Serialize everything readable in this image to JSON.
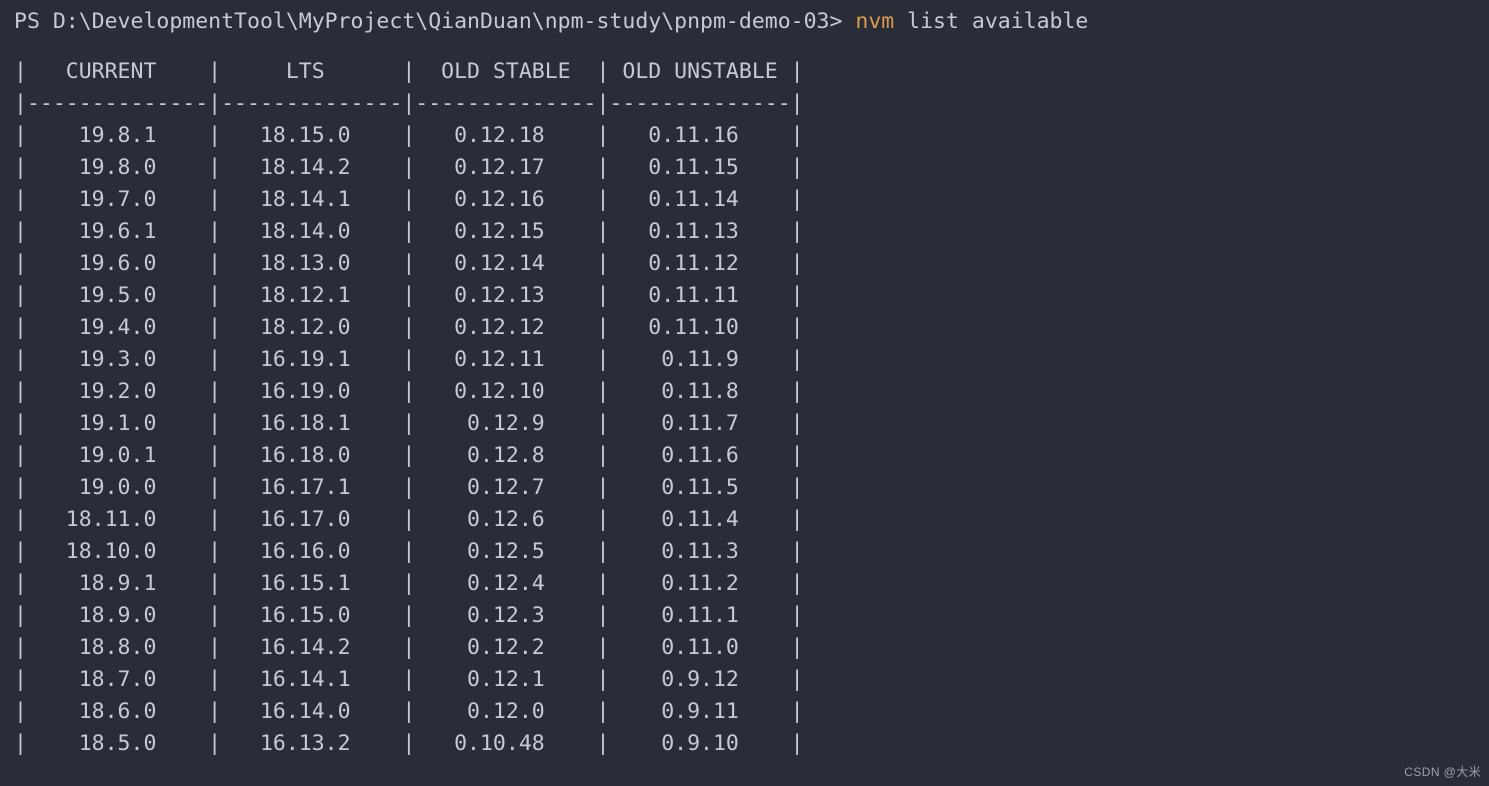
{
  "terminal": {
    "background_color": "#292d38",
    "foreground_color": "#c6cad3",
    "command_color": "#d99a4e",
    "prompt": {
      "shell": "PS",
      "path": "D:\\DevelopmentTool\\MyProject\\QianDuan\\npm-study\\pnpm-demo-03>",
      "prefix_text": "PS D:\\DevelopmentTool\\MyProject\\QianDuan\\npm-study\\pnpm-demo-03> ",
      "command": "nvm",
      "arguments": " list available"
    },
    "watermark": "CSDN @大米"
  },
  "table": {
    "blank_line": "",
    "header_row": "|   CURRENT    |     LTS      |  OLD STABLE  | OLD UNSTABLE |",
    "separator_row": "|--------------|--------------|--------------|--------------|",
    "columns": [
      "CURRENT",
      "LTS",
      "OLD STABLE",
      "OLD UNSTABLE"
    ],
    "rows": [
      "|    19.8.1    |   18.15.0    |   0.12.18    |   0.11.16    |",
      "|    19.8.0    |   18.14.2    |   0.12.17    |   0.11.15    |",
      "|    19.7.0    |   18.14.1    |   0.12.16    |   0.11.14    |",
      "|    19.6.1    |   18.14.0    |   0.12.15    |   0.11.13    |",
      "|    19.6.0    |   18.13.0    |   0.12.14    |   0.11.12    |",
      "|    19.5.0    |   18.12.1    |   0.12.13    |   0.11.11    |",
      "|    19.4.0    |   18.12.0    |   0.12.12    |   0.11.10    |",
      "|    19.3.0    |   16.19.1    |   0.12.11    |    0.11.9    |",
      "|    19.2.0    |   16.19.0    |   0.12.10    |    0.11.8    |",
      "|    19.1.0    |   16.18.1    |    0.12.9    |    0.11.7    |",
      "|    19.0.1    |   16.18.0    |    0.12.8    |    0.11.6    |",
      "|    19.0.0    |   16.17.1    |    0.12.7    |    0.11.5    |",
      "|   18.11.0    |   16.17.0    |    0.12.6    |    0.11.4    |",
      "|   18.10.0    |   16.16.0    |    0.12.5    |    0.11.3    |",
      "|    18.9.1    |   16.15.1    |    0.12.4    |    0.11.2    |",
      "|    18.9.0    |   16.15.0    |    0.12.3    |    0.11.1    |",
      "|    18.8.0    |   16.14.2    |    0.12.2    |    0.11.0    |",
      "|    18.7.0    |   16.14.1    |    0.12.1    |    0.9.12    |",
      "|    18.6.0    |   16.14.0    |    0.12.0    |    0.9.11    |",
      "|    18.5.0    |   16.13.2    |   0.10.48    |    0.9.10    |"
    ],
    "data": [
      {
        "current": "19.8.1",
        "lts": "18.15.0",
        "old_stable": "0.12.18",
        "old_unstable": "0.11.16"
      },
      {
        "current": "19.8.0",
        "lts": "18.14.2",
        "old_stable": "0.12.17",
        "old_unstable": "0.11.15"
      },
      {
        "current": "19.7.0",
        "lts": "18.14.1",
        "old_stable": "0.12.16",
        "old_unstable": "0.11.14"
      },
      {
        "current": "19.6.1",
        "lts": "18.14.0",
        "old_stable": "0.12.15",
        "old_unstable": "0.11.13"
      },
      {
        "current": "19.6.0",
        "lts": "18.13.0",
        "old_stable": "0.12.14",
        "old_unstable": "0.11.12"
      },
      {
        "current": "19.5.0",
        "lts": "18.12.1",
        "old_stable": "0.12.13",
        "old_unstable": "0.11.11"
      },
      {
        "current": "19.4.0",
        "lts": "18.12.0",
        "old_stable": "0.12.12",
        "old_unstable": "0.11.10"
      },
      {
        "current": "19.3.0",
        "lts": "16.19.1",
        "old_stable": "0.12.11",
        "old_unstable": "0.11.9"
      },
      {
        "current": "19.2.0",
        "lts": "16.19.0",
        "old_stable": "0.12.10",
        "old_unstable": "0.11.8"
      },
      {
        "current": "19.1.0",
        "lts": "16.18.1",
        "old_stable": "0.12.9",
        "old_unstable": "0.11.7"
      },
      {
        "current": "19.0.1",
        "lts": "16.18.0",
        "old_stable": "0.12.8",
        "old_unstable": "0.11.6"
      },
      {
        "current": "19.0.0",
        "lts": "16.17.1",
        "old_stable": "0.12.7",
        "old_unstable": "0.11.5"
      },
      {
        "current": "18.11.0",
        "lts": "16.17.0",
        "old_stable": "0.12.6",
        "old_unstable": "0.11.4"
      },
      {
        "current": "18.10.0",
        "lts": "16.16.0",
        "old_stable": "0.12.5",
        "old_unstable": "0.11.3"
      },
      {
        "current": "18.9.1",
        "lts": "16.15.1",
        "old_stable": "0.12.4",
        "old_unstable": "0.11.2"
      },
      {
        "current": "18.9.0",
        "lts": "16.15.0",
        "old_stable": "0.12.3",
        "old_unstable": "0.11.1"
      },
      {
        "current": "18.8.0",
        "lts": "16.14.2",
        "old_stable": "0.12.2",
        "old_unstable": "0.11.0"
      },
      {
        "current": "18.7.0",
        "lts": "16.14.1",
        "old_stable": "0.12.1",
        "old_unstable": "0.9.12"
      },
      {
        "current": "18.6.0",
        "lts": "16.14.0",
        "old_stable": "0.12.0",
        "old_unstable": "0.9.11"
      },
      {
        "current": "18.5.0",
        "lts": "16.13.2",
        "old_stable": "0.10.48",
        "old_unstable": "0.9.10"
      }
    ]
  }
}
